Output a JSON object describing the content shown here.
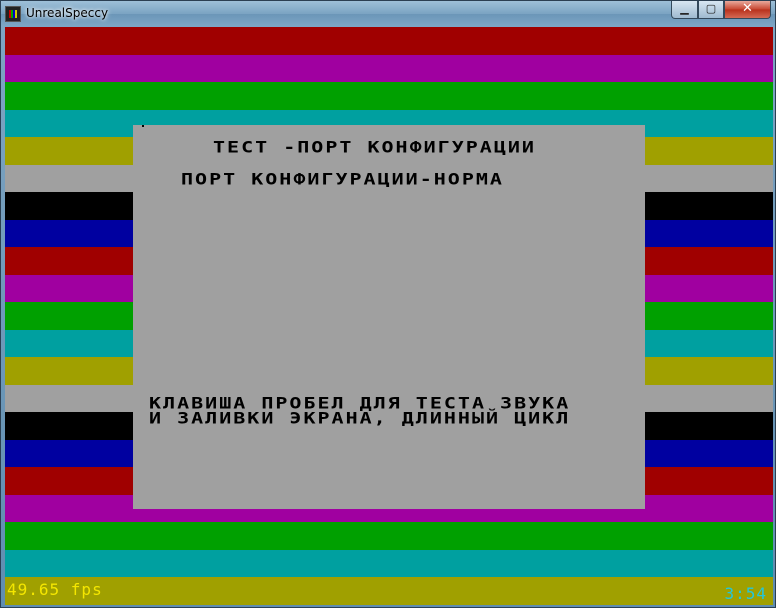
{
  "window": {
    "title": "UnrealSpeccy",
    "controls": {
      "minimize": "▁",
      "maximize": "▢",
      "close": "✕"
    }
  },
  "screen": {
    "border_colors": [
      "#a00000",
      "#a000a0",
      "#00a000",
      "#00a0a0",
      "#a0a000",
      "#a0a0a0",
      "#000000",
      "#0000a0"
    ],
    "paper_color": "#a0a0a0",
    "lines": {
      "test_title": "ТЕСТ -ПОРТ КОНФИГУРАЦИИ",
      "result": "ПОРТ КОНФИГУРАЦИИ-НОРМА",
      "hint_line1": "КЛАВИША ПРОБЕЛ ДЛЯ ТЕСТА ЗВУКА",
      "hint_line2": "И ЗАЛИВКИ ЭКРАНА, ДЛИННЫЙ ЦИКЛ"
    }
  },
  "status": {
    "fps": "49.65 fps",
    "clock": "3:54"
  }
}
